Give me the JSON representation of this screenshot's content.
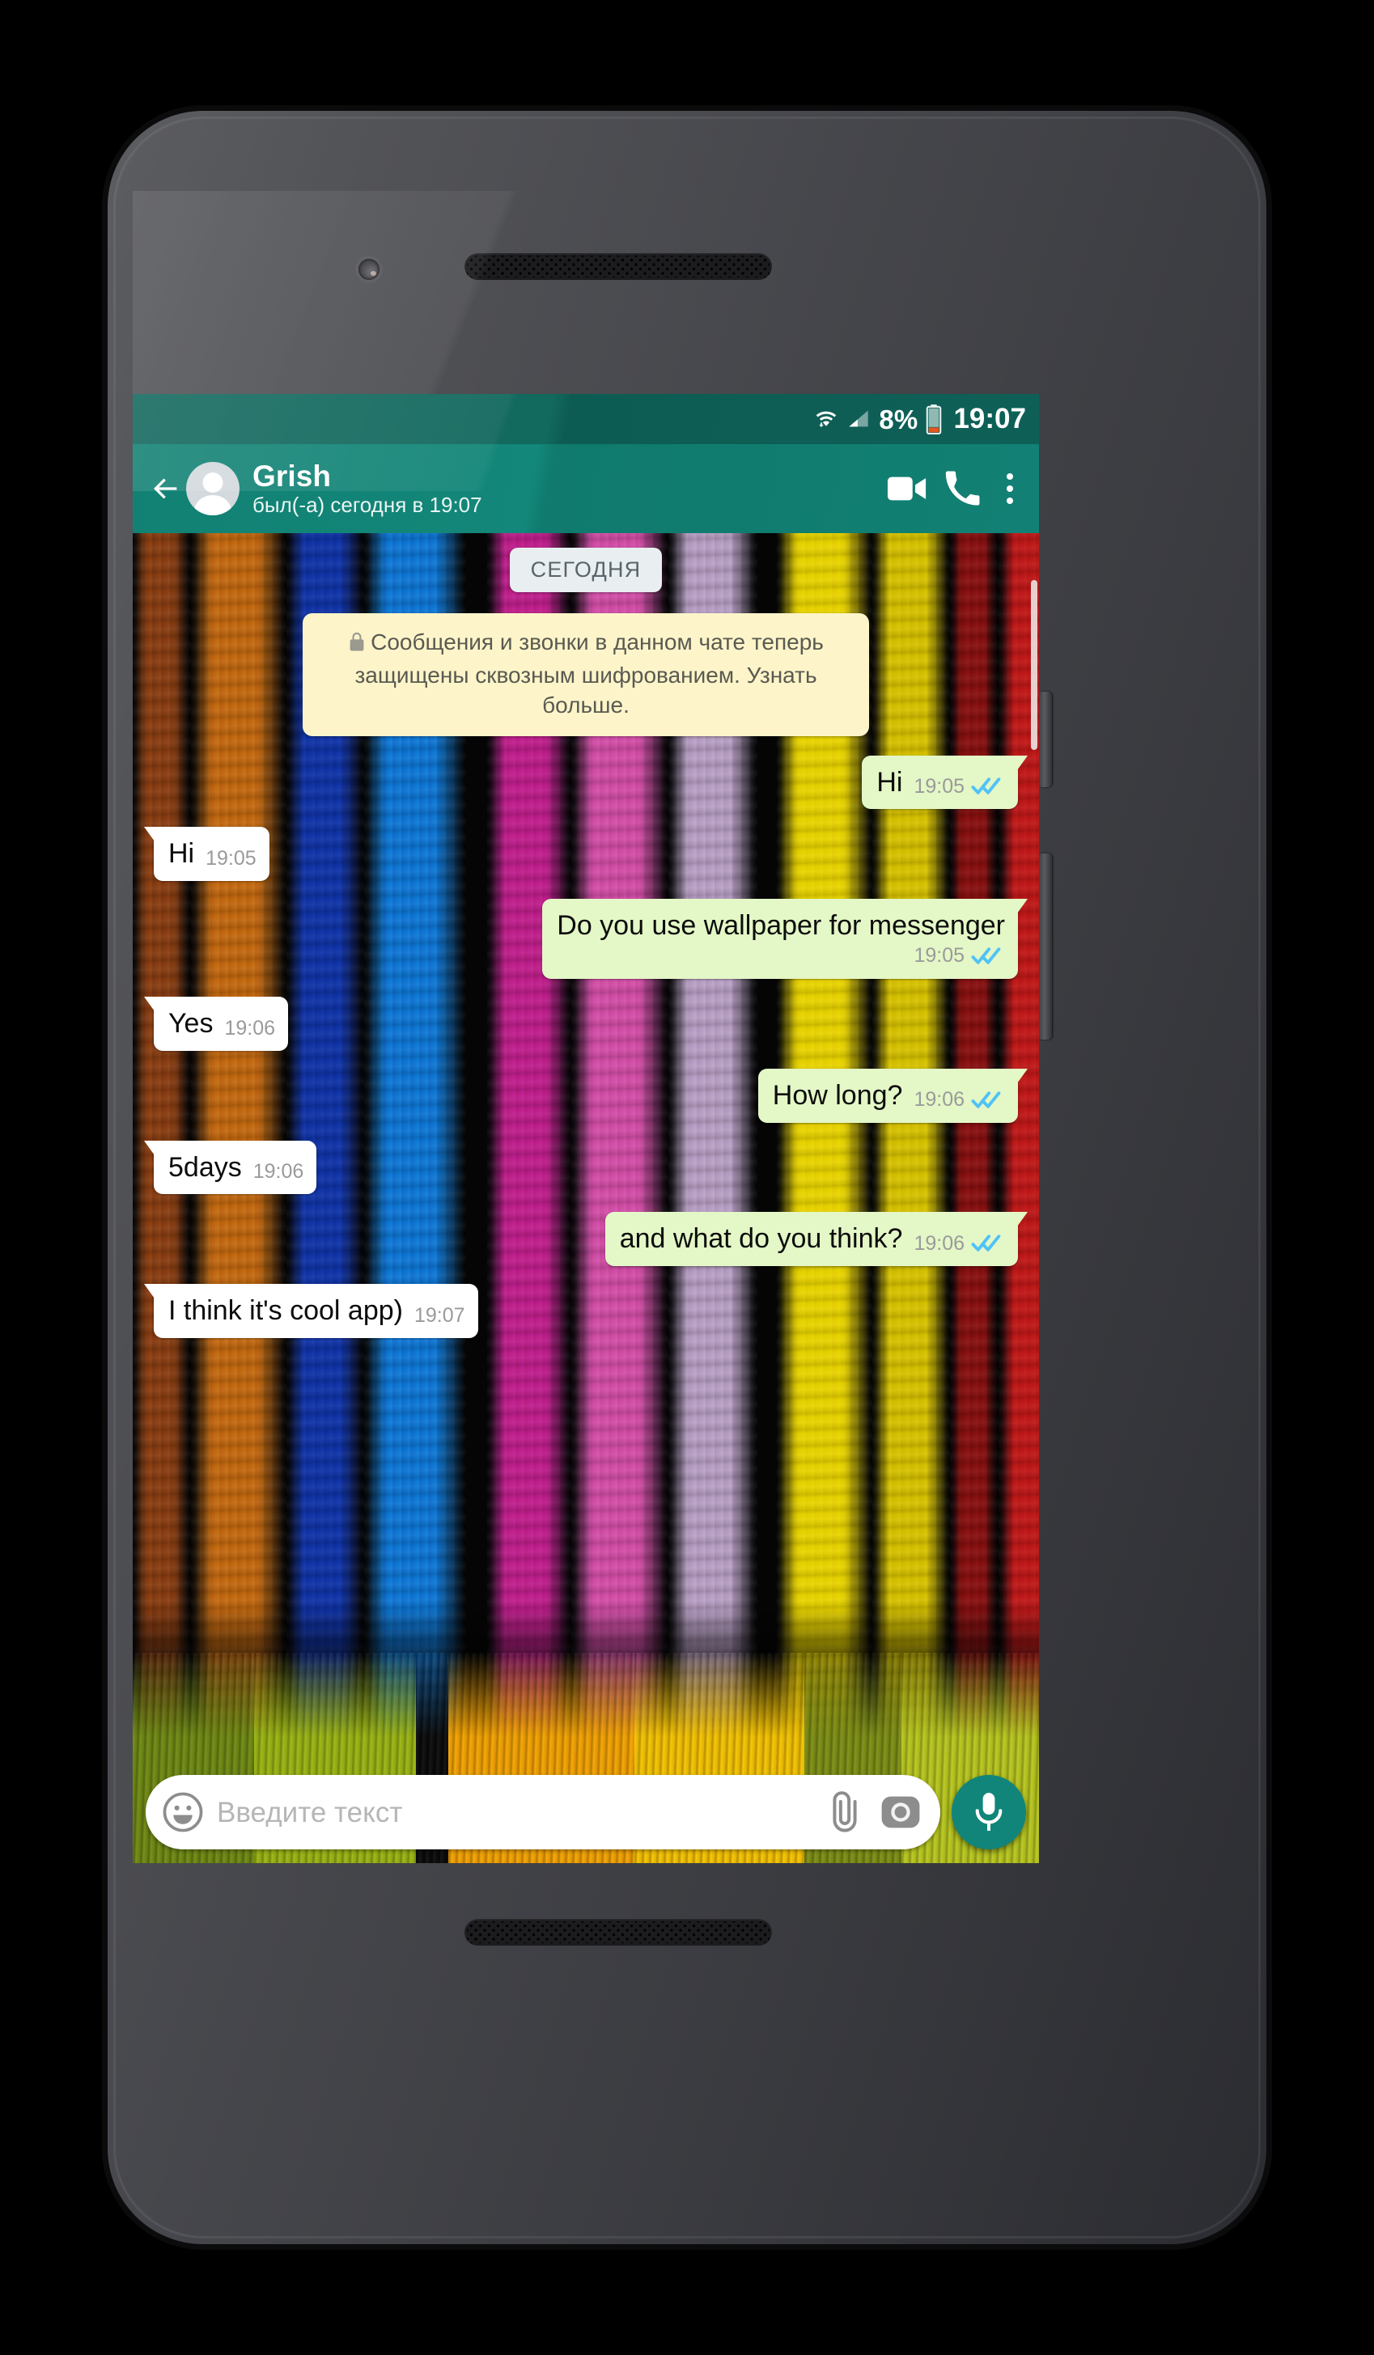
{
  "device": {
    "hardware": {
      "front_camera": "front-camera",
      "earpiece": "earpiece-speaker",
      "bottom_speaker": "bottom-speaker",
      "power_button": "power-button",
      "volume_button": "volume-rocker"
    }
  },
  "status_bar": {
    "wifi_icon": "wifi-icon",
    "signal_icon": "cellular-signal-icon",
    "battery_percent": "8%",
    "battery_icon": "battery-icon",
    "time": "19:07"
  },
  "app_bar": {
    "back_icon": "back-arrow-icon",
    "avatar": "contact-avatar",
    "contact_name": "Grish",
    "last_seen": "был(-а) сегодня в 19:07",
    "video_call_icon": "video-call-icon",
    "voice_call_icon": "phone-call-icon",
    "overflow_icon": "more-options-icon"
  },
  "chat": {
    "day_divider": "СЕГОДНЯ",
    "encryption_notice": {
      "lock_icon": "lock-icon",
      "text": "Сообщения и звонки в данном чате теперь защищены сквозным шифрованием. Узнать больше."
    },
    "messages": [
      {
        "direction": "out",
        "text": "Hi",
        "time": "19:05",
        "status": "read",
        "wrap": false
      },
      {
        "direction": "in",
        "text": "Hi",
        "time": "19:05",
        "status": "",
        "wrap": false
      },
      {
        "direction": "out",
        "text": "Do you use wallpaper for messenger",
        "time": "19:05",
        "status": "read",
        "wrap": true
      },
      {
        "direction": "in",
        "text": "Yes",
        "time": "19:06",
        "status": "",
        "wrap": false
      },
      {
        "direction": "out",
        "text": "How long?",
        "time": "19:06",
        "status": "read",
        "wrap": false
      },
      {
        "direction": "in",
        "text": "5days",
        "time": "19:06",
        "status": "",
        "wrap": false
      },
      {
        "direction": "out",
        "text": "and what do you think?",
        "time": "19:06",
        "status": "read",
        "wrap": false
      },
      {
        "direction": "in",
        "text": "I think it's cool app)",
        "time": "19:07",
        "status": "",
        "wrap": false
      }
    ]
  },
  "composer": {
    "emoji_icon": "emoji-icon",
    "placeholder": "Введите текст",
    "attach_icon": "attachment-clip-icon",
    "camera_icon": "camera-icon",
    "mic_icon": "microphone-icon"
  },
  "colors": {
    "status_bar": "#0f6459",
    "app_bar": "#128376",
    "outgoing_bubble": "#e4f7c7",
    "incoming_bubble": "#ffffff",
    "encryption_bubble": "#fdf5c9",
    "read_tick": "#4fc3f7",
    "mic_button": "#11857a",
    "day_pill": "#e9eef1"
  },
  "wallpaper": {
    "name": "colored-wood-planks-wallpaper",
    "plank_colors": [
      "#8a3e12",
      "#c26a10",
      "#1034a8",
      "#0e78d4",
      "#0a0a0a",
      "#c01f8e",
      "#d24fa8",
      "#b8a0c4",
      "#0a0a0a",
      "#e8d400",
      "#d6c200",
      "#8a1010",
      "#c01818"
    ],
    "floor_colors": [
      "#6f8a12",
      "#9bb512",
      "#0a0a0a",
      "#f5a300",
      "#f7c400",
      "#7e8f14",
      "#b9c81e"
    ]
  }
}
